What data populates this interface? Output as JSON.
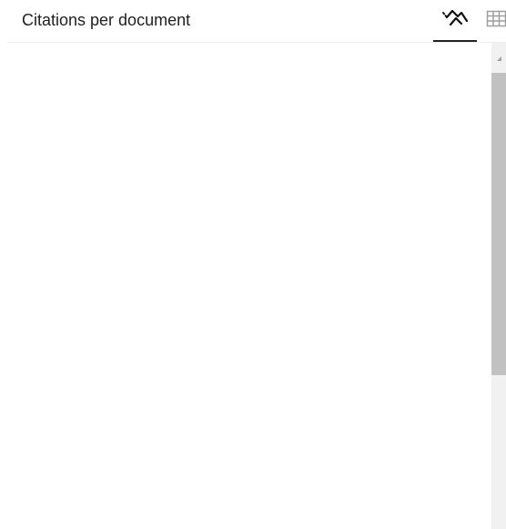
{
  "panel": {
    "title": "Citations per document",
    "view_tabs": [
      {
        "id": "chart",
        "icon": "trending-down-chart-icon",
        "selected": true
      },
      {
        "id": "table",
        "icon": "table-grid-icon",
        "selected": false
      }
    ]
  },
  "colors": {
    "title_text": "#212121",
    "selected_underline": "#212121",
    "icon_active": "#111111",
    "icon_inactive": "#9e9e9e",
    "scroll_track": "#f1f1f1",
    "scroll_thumb": "#c1c1c1"
  }
}
